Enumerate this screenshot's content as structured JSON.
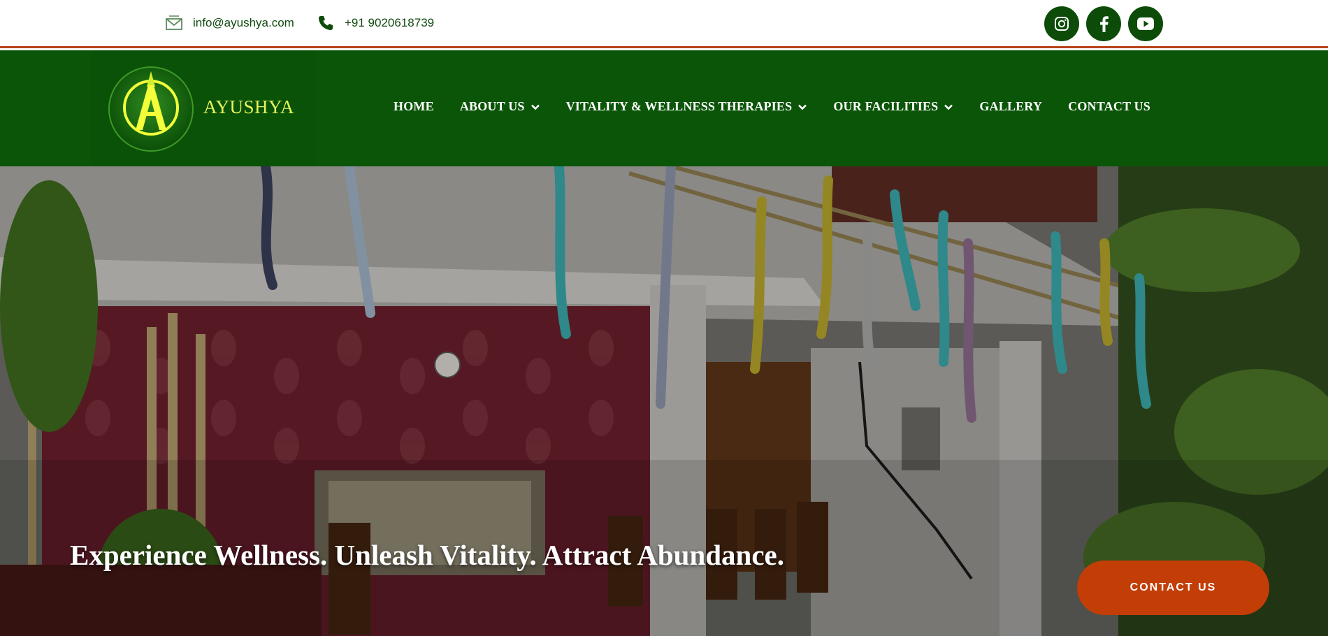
{
  "topbar": {
    "email": "info@ayushya.com",
    "phone": "+91 9020618739",
    "email_icon": "envelope-icon",
    "phone_icon": "phone-icon",
    "socials": [
      "instagram-icon",
      "facebook-icon",
      "youtube-icon"
    ]
  },
  "brand": {
    "name": "AYUSHYA",
    "mark_letter": "A"
  },
  "nav": {
    "items": [
      {
        "label": "HOME",
        "dropdown": false
      },
      {
        "label": "ABOUT US",
        "dropdown": true
      },
      {
        "label": "VITALITY & WELLNESS THERAPIES",
        "dropdown": true
      },
      {
        "label": "OUR FACILITIES",
        "dropdown": true
      },
      {
        "label": "GALLERY",
        "dropdown": false
      },
      {
        "label": "CONTACT US",
        "dropdown": false
      }
    ]
  },
  "hero": {
    "headline": "Experience Wellness. Unleash Vitality. Attract Abundance.",
    "cta_label": "CONTACT US"
  },
  "colors": {
    "nav_green": "#0b5509",
    "accent_orange": "#c33d07",
    "logo_yellow": "#e6f35b",
    "divider": "#b8441a"
  }
}
